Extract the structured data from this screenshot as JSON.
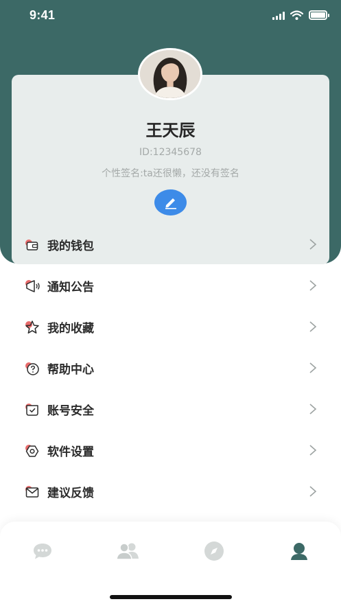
{
  "status_bar": {
    "time": "9:41"
  },
  "profile": {
    "name": "王天辰",
    "id_text": "ID:12345678",
    "signature": "个性签名:ta还很懒，还没有签名"
  },
  "menu": [
    {
      "label": "我的钱包",
      "icon": "wallet-icon"
    },
    {
      "label": "通知公告",
      "icon": "announcement-icon"
    },
    {
      "label": "我的收藏",
      "icon": "star-icon"
    },
    {
      "label": "帮助中心",
      "icon": "help-icon"
    },
    {
      "label": "账号安全",
      "icon": "shield-icon"
    },
    {
      "label": "软件设置",
      "icon": "settings-icon"
    },
    {
      "label": "建议反馈",
      "icon": "feedback-icon"
    }
  ],
  "tabs": [
    {
      "name": "messages",
      "icon": "chat-bubble-icon",
      "active": false
    },
    {
      "name": "contacts",
      "icon": "contacts-icon",
      "active": false
    },
    {
      "name": "discover",
      "icon": "compass-icon",
      "active": false
    },
    {
      "name": "profile",
      "icon": "person-icon",
      "active": true
    }
  ],
  "colors": {
    "header": "#3c6966",
    "card": "#e8edec",
    "accent_red": "#e86a6a",
    "edit_button": "#3d8be8",
    "tab_inactive": "#d4d8d7",
    "tab_active": "#3c6966"
  }
}
